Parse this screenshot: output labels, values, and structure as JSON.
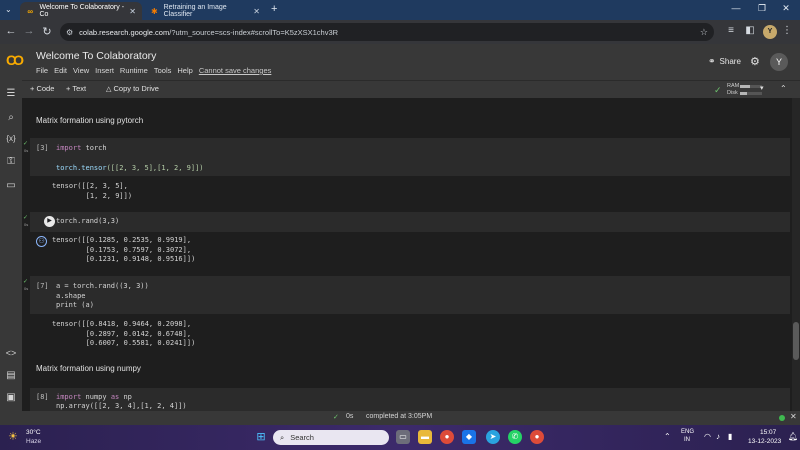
{
  "browser": {
    "tabs": [
      {
        "title": "Welcome To Colaboratory - Co",
        "active": true
      },
      {
        "title": "Retraining an Image Classifier",
        "active": false
      }
    ],
    "new_tab": "+",
    "url_host": "colab.research.google.com",
    "url_path": "/?utm_source=scs-index#scrollTo=K5zXSX1chv3R",
    "profile_initial": "Y"
  },
  "colab": {
    "title": "Welcome To Colaboratory",
    "menu": [
      "File",
      "Edit",
      "View",
      "Insert",
      "Runtime",
      "Tools",
      "Help"
    ],
    "menu_warning": "Cannot save changes",
    "share_label": "Share",
    "avatar_initial": "Y",
    "toolbar": {
      "code": "+ Code",
      "text": "+ Text",
      "copy_to_drive": "Copy to Drive",
      "ram": "RAM",
      "disk": "Disk",
      "ram_level": 0.45,
      "disk_level": 0.3
    }
  },
  "notebook": {
    "md1": "Matrix formation using pytorch",
    "cell3": {
      "num": "[3]",
      "import_kw": "import",
      "import_mod": "torch",
      "line2_fn": "torch.tensor",
      "line2_args": "([[2, 3, 5],[1, 2, 9]])"
    },
    "out3": {
      "l1": "tensor([[2, 3, 5],",
      "l2": "        [1, 2, 9]])"
    },
    "cell4": {
      "code": "torch.rand(3,3)"
    },
    "out4": {
      "l1": "tensor([[0.1285, 0.2535, 0.9919],",
      "l2": "        [0.1753, 0.7597, 0.3072],",
      "l3": "        [0.1231, 0.9148, 0.9516]])"
    },
    "cell7": {
      "num": "[7]",
      "l1": "a = torch.rand((3, 3))",
      "l2": "a.shape",
      "l3": "print (a)"
    },
    "out7": {
      "l1": "tensor([[0.8418, 0.9464, 0.2098],",
      "l2": "        [0.2897, 0.0142, 0.6748],",
      "l3": "        [0.6007, 0.5581, 0.0241]])"
    },
    "md2": "Matrix formation using numpy",
    "cell8": {
      "num": "[8]",
      "import_kw": "import",
      "import_rest": "numpy",
      "as_kw": "as",
      "alias": "np",
      "l2": "np.array([[2, 3, 4],[1, 2, 4]])"
    },
    "cell_time": "0s"
  },
  "statusbar": {
    "check": "✓",
    "time": "0s",
    "completed": "completed at 3:05PM"
  },
  "taskbar": {
    "temp": "30°C",
    "weather": "Haze",
    "search": "Search",
    "lang1": "ENG",
    "lang2": "IN",
    "time": "15:07",
    "date": "13-12-2023"
  }
}
